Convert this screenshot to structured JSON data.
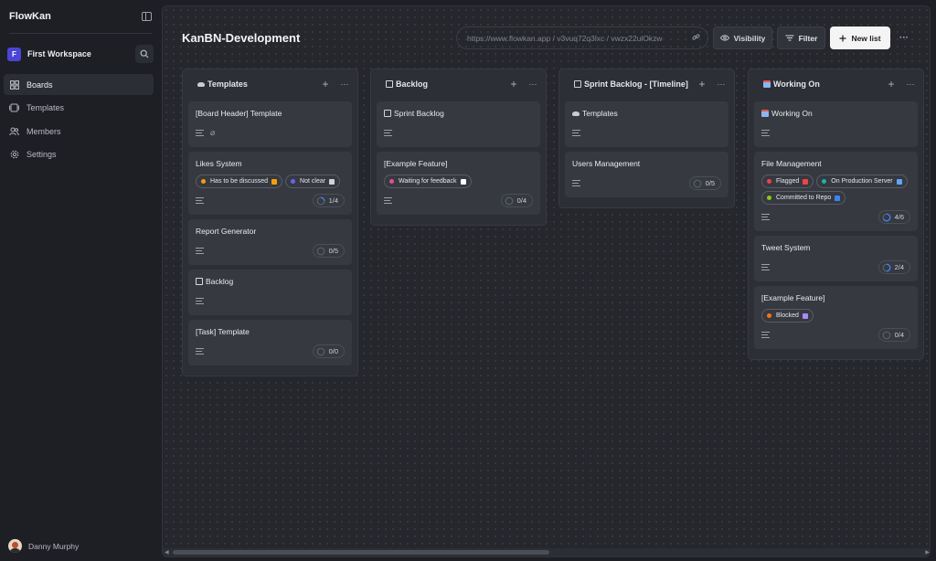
{
  "app": {
    "brand": "FlowKan"
  },
  "workspace": {
    "initial": "F",
    "name": "First Workspace"
  },
  "nav": {
    "items": [
      {
        "label": "Boards",
        "icon": "boards-icon",
        "active": true
      },
      {
        "label": "Templates",
        "icon": "templates-icon",
        "active": false
      },
      {
        "label": "Members",
        "icon": "members-icon",
        "active": false
      },
      {
        "label": "Settings",
        "icon": "settings-icon",
        "active": false
      }
    ]
  },
  "user": {
    "name": "Danny Murphy"
  },
  "board": {
    "title": "KanBN-Development",
    "url": "https://www.flowkan.app / v3vuq72q3lxc / vwzx22ulOkzw",
    "visibility_label": "Visibility",
    "filter_label": "Filter",
    "new_list_label": "New list",
    "more_label": "···"
  },
  "colors": {
    "accent": "#4b45d6",
    "progress_ring": "#3b82f6",
    "orange": "#f59e0b",
    "purple": "#6366f1",
    "pink": "#ec4899",
    "red": "#ef4444",
    "teal": "#14b8a6",
    "green": "#84cc16"
  },
  "lists": [
    {
      "title": "Templates",
      "icon": "hat-icon",
      "cards": [
        {
          "title": "[Board Header] Template",
          "attachment": true
        },
        {
          "title": "Likes System",
          "labels": [
            {
              "text": "Has to be discussed",
              "dot": "#f59e0b",
              "emoji": "#f59e0b"
            },
            {
              "text": "Not clear",
              "dot": "#6366f1",
              "emoji": "#cfd3da"
            }
          ],
          "progress": "1/4",
          "progress_value": 0.25
        },
        {
          "title": "Report Generator",
          "progress": "0/5",
          "progress_value": 0
        },
        {
          "title": "Backlog",
          "icon": "note-icon"
        },
        {
          "title": "[Task] Template",
          "progress": "0/0",
          "progress_value": 0
        }
      ]
    },
    {
      "title": "Backlog",
      "icon": "note-icon",
      "cards": [
        {
          "title": "Sprint Backlog",
          "icon": "doc-icon"
        },
        {
          "title": "[Example Feature]",
          "labels": [
            {
              "text": "Waiting for feedback",
              "dot": "#ec4899",
              "emoji": "#ffffff"
            }
          ],
          "progress": "0/4",
          "progress_value": 0
        }
      ]
    },
    {
      "title": "Sprint Backlog - [Timeline]",
      "icon": "doc-icon",
      "cards": [
        {
          "title": "Templates",
          "icon": "hat-icon"
        },
        {
          "title": "Users Management",
          "progress": "0/5",
          "progress_value": 0
        }
      ]
    },
    {
      "title": "Working On",
      "icon": "calendar-icon",
      "cards": [
        {
          "title": "Working On",
          "icon": "calendar-icon"
        },
        {
          "title": "File Management",
          "labels": [
            {
              "text": "Flagged",
              "dot": "#ef4444",
              "emoji": "#ef4444"
            },
            {
              "text": "On Production Server",
              "dot": "#14b8a6",
              "emoji": "#60a5fa"
            },
            {
              "text": "Committed to Repo",
              "dot": "#84cc16",
              "emoji": "#3b82f6"
            }
          ],
          "progress": "4/6",
          "progress_value": 0.67
        },
        {
          "title": "Tweet System",
          "progress": "2/4",
          "progress_value": 0.5
        },
        {
          "title": "[Example Feature]",
          "labels": [
            {
              "text": "Blocked",
              "dot": "#f97316",
              "emoji": "#a78bfa"
            }
          ],
          "progress": "0/4",
          "progress_value": 0
        }
      ]
    }
  ]
}
